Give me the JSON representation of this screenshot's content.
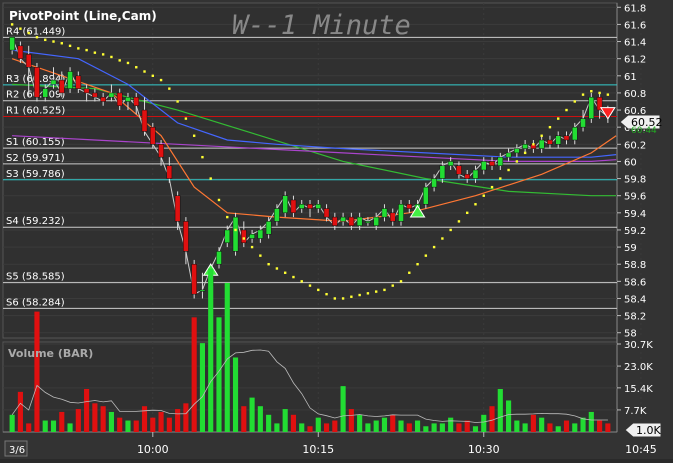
{
  "indicator_label": "PivotPoint (Line,Cam)",
  "watermark": "W--1 Minute",
  "volume_label": "Volume (BAR)",
  "date_label": "3/6",
  "price_tag": "60.52",
  "price_tag_under": "60.44",
  "volume_tag": "1.0K",
  "colors": {
    "background": "#333333",
    "grid": "#000000",
    "up_candle": "#22dd33",
    "down_candle": "#e01010",
    "pivot_cyan": "#33cccc",
    "pivot_red": "#cc1111",
    "sar_dots": "#ffff33",
    "ma_green": "#33bb33",
    "ma_blue": "#4466ff",
    "ma_orange": "#ff7733",
    "ma_purple": "#aa44cc",
    "price_line": "#cccccc"
  },
  "chart_data": {
    "type": "candlestick",
    "timeframe": "1 Minute",
    "y_ticks": [
      "61.8",
      "61.6",
      "61.4",
      "61.2",
      "61",
      "60.8",
      "60.6",
      "60.4",
      "60.2",
      "60",
      "59.8",
      "59.6",
      "59.4",
      "59.2",
      "59",
      "58.8",
      "58.6",
      "58.4",
      "58.2",
      "58"
    ],
    "ylim": [
      57.95,
      61.85
    ],
    "x_ticks": [
      "10:00",
      "10:15",
      "10:30",
      "10:45"
    ],
    "x_tick_slots": [
      17,
      37,
      57,
      76
    ],
    "pivots": [
      {
        "name": "R4",
        "label": "R4 (61.449)",
        "value": 61.449,
        "color": "#cccccc"
      },
      {
        "name": "R3",
        "label": "R3 (60.894)",
        "value": 60.894,
        "color": "#33cccc"
      },
      {
        "name": "R2",
        "label": "R2 (60.709)",
        "value": 60.709,
        "color": "#cccccc"
      },
      {
        "name": "R1",
        "label": "R1 (60.525)",
        "value": 60.525,
        "color": "#cc1111"
      },
      {
        "name": "S1",
        "label": "S1 (60.155)",
        "value": 60.155,
        "color": "#cccccc"
      },
      {
        "name": "S2",
        "label": "S2 (59.971)",
        "value": 59.971,
        "color": "#cccccc"
      },
      {
        "name": "S3",
        "label": "S3 (59.786)",
        "value": 59.786,
        "color": "#33cccc"
      },
      {
        "name": "S4",
        "label": "S4 (59.232)",
        "value": 59.232,
        "color": "#cccccc"
      },
      {
        "name": "S5",
        "label": "S5 (58.585)",
        "value": 58.585,
        "color": "#cccccc"
      },
      {
        "name": "S6",
        "label": "S6 (58.284)",
        "value": 58.284,
        "color": "#cccccc"
      }
    ],
    "candles": [
      [
        61.3,
        61.45,
        61.45,
        61.25
      ],
      [
        61.35,
        61.2,
        61.4,
        61.15
      ],
      [
        61.25,
        61.1,
        61.35,
        60.75
      ],
      [
        61.1,
        60.75,
        61.15,
        60.7
      ],
      [
        60.75,
        60.85,
        60.9,
        60.7
      ],
      [
        60.9,
        60.95,
        61.1,
        60.85
      ],
      [
        60.95,
        60.8,
        61.05,
        60.75
      ],
      [
        60.85,
        61.05,
        61.1,
        60.8
      ],
      [
        61.0,
        60.85,
        61.05,
        60.8
      ],
      [
        60.85,
        60.8,
        60.9,
        60.7
      ],
      [
        60.8,
        60.75,
        60.85,
        60.7
      ],
      [
        60.75,
        60.7,
        60.8,
        60.65
      ],
      [
        60.75,
        60.8,
        60.9,
        60.7
      ],
      [
        60.8,
        60.65,
        60.85,
        60.6
      ],
      [
        60.7,
        60.75,
        60.8,
        60.6
      ],
      [
        60.75,
        60.65,
        60.8,
        60.55
      ],
      [
        60.6,
        60.35,
        60.75,
        60.3
      ],
      [
        60.4,
        60.2,
        60.45,
        60.15
      ],
      [
        60.2,
        60.05,
        60.25,
        59.95
      ],
      [
        59.95,
        59.8,
        60.05,
        59.75
      ],
      [
        59.6,
        59.3,
        59.65,
        59.2
      ],
      [
        59.3,
        58.95,
        59.35,
        58.8
      ],
      [
        58.8,
        58.45,
        58.85,
        58.4
      ],
      [
        58.5,
        58.5,
        58.7,
        58.4
      ],
      [
        58.55,
        58.75,
        58.8,
        58.5
      ],
      [
        58.8,
        58.95,
        59.0,
        58.75
      ],
      [
        59.05,
        59.2,
        59.25,
        59.0
      ],
      [
        58.95,
        59.35,
        59.4,
        58.9
      ],
      [
        59.2,
        59.05,
        59.3,
        59.0
      ],
      [
        59.1,
        59.15,
        59.2,
        59.05
      ],
      [
        59.1,
        59.2,
        59.25,
        59.05
      ],
      [
        59.15,
        59.3,
        59.35,
        59.1
      ],
      [
        59.3,
        59.45,
        59.5,
        59.25
      ],
      [
        59.4,
        59.6,
        59.65,
        59.35
      ],
      [
        59.55,
        59.4,
        59.6,
        59.35
      ],
      [
        59.45,
        59.5,
        59.55,
        59.4
      ],
      [
        59.5,
        59.45,
        59.55,
        59.35
      ],
      [
        59.45,
        59.5,
        59.55,
        59.4
      ],
      [
        59.45,
        59.35,
        59.5,
        59.3
      ],
      [
        59.35,
        59.25,
        59.4,
        59.2
      ],
      [
        59.3,
        59.35,
        59.4,
        59.25
      ],
      [
        59.35,
        59.25,
        59.4,
        59.2
      ],
      [
        59.25,
        59.35,
        59.4,
        59.2
      ],
      [
        59.3,
        59.3,
        59.35,
        59.25
      ],
      [
        59.25,
        59.35,
        59.4,
        59.2
      ],
      [
        59.35,
        59.45,
        59.5,
        59.3
      ],
      [
        59.4,
        59.3,
        59.45,
        59.25
      ],
      [
        59.3,
        59.5,
        59.55,
        59.25
      ],
      [
        59.5,
        59.45,
        59.55,
        59.4
      ],
      [
        59.45,
        59.5,
        59.55,
        59.4
      ],
      [
        59.5,
        59.7,
        59.75,
        59.45
      ],
      [
        59.7,
        59.8,
        59.85,
        59.65
      ],
      [
        59.8,
        59.95,
        60.0,
        59.75
      ],
      [
        59.95,
        60.0,
        60.05,
        59.9
      ],
      [
        59.95,
        59.85,
        60.0,
        59.8
      ],
      [
        59.85,
        59.8,
        59.9,
        59.75
      ],
      [
        59.8,
        59.9,
        59.95,
        59.75
      ],
      [
        59.9,
        60.0,
        60.05,
        59.85
      ],
      [
        60.0,
        59.95,
        60.05,
        59.9
      ],
      [
        59.95,
        60.05,
        60.1,
        59.9
      ],
      [
        60.05,
        60.1,
        60.15,
        60.0
      ],
      [
        60.1,
        60.15,
        60.2,
        60.05
      ],
      [
        60.15,
        60.2,
        60.25,
        60.1
      ],
      [
        60.2,
        60.15,
        60.25,
        60.1
      ],
      [
        60.15,
        60.25,
        60.3,
        60.1
      ],
      [
        60.25,
        60.2,
        60.3,
        60.15
      ],
      [
        60.2,
        60.3,
        60.35,
        60.15
      ],
      [
        60.3,
        60.25,
        60.35,
        60.2
      ],
      [
        60.25,
        60.4,
        60.45,
        60.2
      ],
      [
        60.4,
        60.5,
        60.6,
        60.35
      ],
      [
        60.5,
        60.75,
        60.8,
        60.45
      ],
      [
        60.75,
        60.6,
        60.8,
        60.5
      ],
      [
        60.6,
        60.52,
        60.65,
        60.45
      ]
    ],
    "sar": [
      [
        0,
        61.6
      ],
      [
        1,
        61.55
      ],
      [
        2,
        61.5
      ],
      [
        3,
        61.45
      ],
      [
        4,
        61.42
      ],
      [
        5,
        61.4
      ],
      [
        6,
        61.38
      ],
      [
        7,
        61.35
      ],
      [
        8,
        61.32
      ],
      [
        9,
        61.3
      ],
      [
        10,
        61.27
      ],
      [
        11,
        61.25
      ],
      [
        12,
        61.22
      ],
      [
        13,
        61.18
      ],
      [
        14,
        61.15
      ],
      [
        15,
        61.1
      ],
      [
        16,
        61.05
      ],
      [
        17,
        61.0
      ],
      [
        18,
        60.95
      ],
      [
        19,
        60.85
      ],
      [
        20,
        60.7
      ],
      [
        21,
        60.5
      ],
      [
        22,
        60.3
      ],
      [
        23,
        60.05
      ],
      [
        24,
        59.8
      ],
      [
        25,
        59.55
      ],
      [
        26,
        59.35
      ],
      [
        27,
        59.2
      ],
      [
        28,
        59.1
      ],
      [
        29,
        59.0
      ],
      [
        30,
        58.9
      ],
      [
        31,
        58.8
      ],
      [
        32,
        58.75
      ],
      [
        33,
        58.7
      ],
      [
        34,
        58.65
      ],
      [
        35,
        58.6
      ],
      [
        36,
        58.55
      ],
      [
        37,
        58.5
      ],
      [
        38,
        58.45
      ],
      [
        39,
        58.4
      ],
      [
        40,
        58.4
      ],
      [
        41,
        58.42
      ],
      [
        42,
        58.44
      ],
      [
        43,
        58.46
      ],
      [
        44,
        58.48
      ],
      [
        45,
        58.5
      ],
      [
        46,
        58.55
      ],
      [
        47,
        58.6
      ],
      [
        48,
        58.7
      ],
      [
        49,
        58.8
      ],
      [
        50,
        58.9
      ],
      [
        51,
        59.0
      ],
      [
        52,
        59.1
      ],
      [
        53,
        59.2
      ],
      [
        54,
        59.3
      ],
      [
        55,
        59.4
      ],
      [
        56,
        59.5
      ],
      [
        57,
        59.6
      ],
      [
        58,
        59.7
      ],
      [
        59,
        59.8
      ],
      [
        60,
        59.9
      ],
      [
        61,
        60.0
      ],
      [
        62,
        60.1
      ],
      [
        63,
        60.2
      ],
      [
        64,
        60.3
      ],
      [
        65,
        60.4
      ],
      [
        66,
        60.5
      ],
      [
        67,
        60.6
      ],
      [
        68,
        60.7
      ],
      [
        69,
        60.78
      ],
      [
        70,
        60.82
      ],
      [
        71,
        60.8
      ],
      [
        72,
        60.78
      ]
    ],
    "ma_lines": [
      {
        "color": "#33bb33",
        "points": [
          [
            0,
            60.9
          ],
          [
            10,
            60.85
          ],
          [
            20,
            60.6
          ],
          [
            30,
            60.3
          ],
          [
            40,
            60.0
          ],
          [
            50,
            59.8
          ],
          [
            60,
            59.65
          ],
          [
            70,
            59.6
          ],
          [
            73,
            59.6
          ]
        ]
      },
      {
        "color": "#4466ff",
        "points": [
          [
            0,
            61.3
          ],
          [
            8,
            61.2
          ],
          [
            14,
            60.9
          ],
          [
            20,
            60.45
          ],
          [
            26,
            60.25
          ],
          [
            32,
            60.2
          ],
          [
            40,
            60.15
          ],
          [
            50,
            60.1
          ],
          [
            60,
            60.05
          ],
          [
            70,
            60.05
          ],
          [
            73,
            60.08
          ]
        ]
      },
      {
        "color": "#aa44cc",
        "points": [
          [
            0,
            60.3
          ],
          [
            10,
            60.25
          ],
          [
            20,
            60.2
          ],
          [
            30,
            60.15
          ],
          [
            40,
            60.1
          ],
          [
            50,
            60.05
          ],
          [
            60,
            60.0
          ],
          [
            70,
            60.0
          ],
          [
            73,
            60.02
          ]
        ]
      },
      {
        "color": "#ff7733",
        "points": [
          [
            0,
            61.2
          ],
          [
            6,
            61.0
          ],
          [
            12,
            60.8
          ],
          [
            18,
            60.3
          ],
          [
            22,
            59.7
          ],
          [
            26,
            59.4
          ],
          [
            32,
            59.35
          ],
          [
            40,
            59.3
          ],
          [
            48,
            59.4
          ],
          [
            56,
            59.6
          ],
          [
            64,
            59.85
          ],
          [
            70,
            60.1
          ],
          [
            73,
            60.3
          ]
        ]
      }
    ],
    "volumes": [
      6,
      14,
      3,
      42,
      4,
      4,
      7,
      3,
      8,
      15,
      10,
      9,
      7,
      5,
      4,
      4,
      9,
      5,
      7,
      5,
      8,
      10,
      40,
      31,
      57,
      40,
      52,
      26,
      9,
      12,
      9,
      6,
      3,
      8,
      6,
      3,
      2,
      5,
      3,
      4,
      16,
      8,
      6,
      3,
      4,
      5,
      6,
      4,
      3,
      4,
      2,
      3,
      3,
      5,
      3,
      4,
      2,
      6,
      9,
      15,
      11,
      4,
      3,
      6,
      5,
      3,
      2,
      4,
      3,
      5,
      7,
      4,
      3
    ],
    "vol_ticks": [
      "30.7K",
      "23.0K",
      "15.4K",
      "7.7K"
    ],
    "vol_max": 30.7
  }
}
